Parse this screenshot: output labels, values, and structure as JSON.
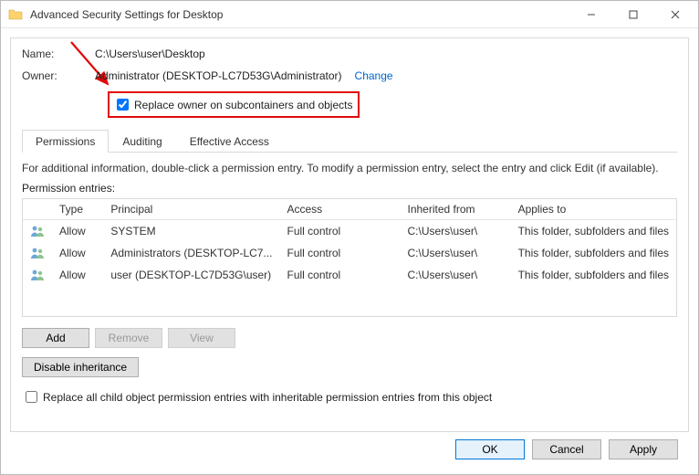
{
  "window": {
    "title": "Advanced Security Settings for Desktop"
  },
  "fields": {
    "name_label": "Name:",
    "name_value": "C:\\Users\\user\\Desktop",
    "owner_label": "Owner:",
    "owner_value": "Administrator (DESKTOP-LC7D53G\\Administrator)",
    "change_link": "Change",
    "replace_owner_label": "Replace owner on subcontainers and objects",
    "replace_owner_checked": true
  },
  "tabs": {
    "permissions": "Permissions",
    "auditing": "Auditing",
    "effective_access": "Effective Access"
  },
  "info_text": "For additional information, double-click a permission entry. To modify a permission entry, select the entry and click Edit (if available).",
  "entries_label": "Permission entries:",
  "table": {
    "headers": {
      "type": "Type",
      "principal": "Principal",
      "access": "Access",
      "inherited": "Inherited from",
      "applies": "Applies to"
    },
    "rows": [
      {
        "type": "Allow",
        "principal": "SYSTEM",
        "access": "Full control",
        "inherited": "C:\\Users\\user\\",
        "applies": "This folder, subfolders and files"
      },
      {
        "type": "Allow",
        "principal": "Administrators (DESKTOP-LC7...",
        "access": "Full control",
        "inherited": "C:\\Users\\user\\",
        "applies": "This folder, subfolders and files"
      },
      {
        "type": "Allow",
        "principal": "user (DESKTOP-LC7D53G\\user)",
        "access": "Full control",
        "inherited": "C:\\Users\\user\\",
        "applies": "This folder, subfolders and files"
      }
    ]
  },
  "buttons": {
    "add": "Add",
    "remove": "Remove",
    "view": "View",
    "disable_inheritance": "Disable inheritance",
    "ok": "OK",
    "cancel": "Cancel",
    "apply": "Apply"
  },
  "replace_all_label": "Replace all child object permission entries with inheritable permission entries from this object",
  "replace_all_checked": false
}
